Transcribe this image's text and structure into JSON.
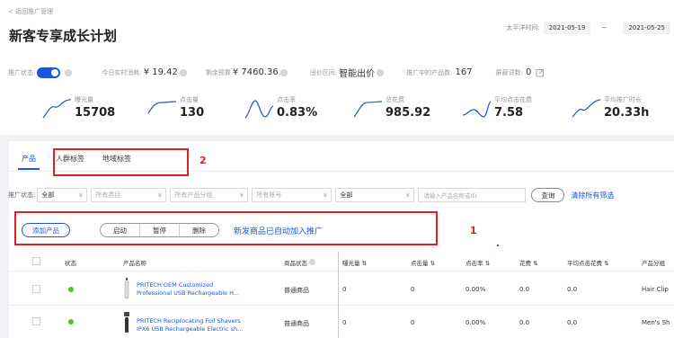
{
  "header": {
    "back_link": "< 返回推广管理",
    "title": "新客专享成长计划",
    "date_label": "太平洋时间:",
    "date_start": "2021-05-19",
    "date_sep": "~",
    "date_end": "2021-05-25"
  },
  "status": {
    "label": "推广状态:",
    "today_spend_label": "今日实时消耗:",
    "today_spend_value": "¥ 19.42",
    "remaining_label": "剩余预算",
    "remaining_value": "¥ 7460.36",
    "bid_label": "出价区间:",
    "bid_value": "智能出价",
    "products_label": "推广中的产品数:",
    "products_value": "167",
    "blocked_label": "屏蔽词数:",
    "blocked_value": "0"
  },
  "metrics": [
    {
      "label": "曝光量",
      "value": "15708"
    },
    {
      "label": "点击量",
      "value": "130"
    },
    {
      "label": "点击率",
      "value": "0.83%"
    },
    {
      "label": "总花费",
      "value": "985.92"
    },
    {
      "label": "平均点击花费",
      "value": "7.58"
    },
    {
      "label": "平均推广时长",
      "value": "20.33h"
    }
  ],
  "tabs": [
    "产品",
    "人群标签",
    "地域标签"
  ],
  "filters": {
    "status_label": "推广状态:",
    "status_value": "全部",
    "category": "所有类目",
    "group": "所有产品分组",
    "account": "所有账号",
    "all2": "全部",
    "search_placeholder": "请输入产品名称或ID",
    "query_btn": "查询",
    "clear_btn": "清除所有筛选"
  },
  "actions": {
    "add": "添加产品",
    "start": "启动",
    "pause": "暂停",
    "delete": "删除",
    "notice": "新发商品已自动加入推广"
  },
  "annotations": {
    "box1": "1",
    "box2": "2"
  },
  "table": {
    "headers": [
      "状态",
      "产品名称",
      "商品状态",
      "曝光量",
      "点击量",
      "点击率",
      "花费",
      "平均点击花费",
      "产品分组"
    ],
    "rows": [
      {
        "name1": "PRITECH OEM Customized",
        "name2": "Professional USB Rechargeable H...",
        "product_status": "普通商品",
        "impressions": "0",
        "clicks": "0",
        "ctr": "0.00%",
        "spend": "0.0",
        "cpc": "0.0",
        "group": "Hair Clip"
      },
      {
        "name1": "PRITECH Reciprocating Foil Shavers",
        "name2": "IPX6 USB Rechargeable Electric sh...",
        "product_status": "普通商品",
        "impressions": "0",
        "clicks": "0",
        "ctr": "0.00%",
        "spend": "0.0",
        "cpc": "0.0",
        "group": "Men's Sh"
      }
    ]
  },
  "colors": {
    "accent": "#1a56db",
    "annotation": "#e02020",
    "status_on": "#52c41a"
  }
}
